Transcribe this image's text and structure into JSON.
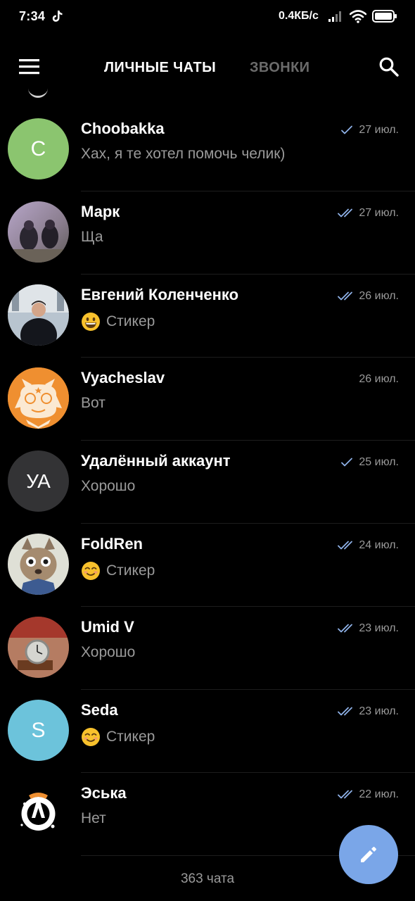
{
  "status_bar": {
    "time": "7:34",
    "net_speed": "0.4КБ/с"
  },
  "app_bar": {
    "tab_chats": "ЛИЧНЫЕ ЧАТЫ",
    "tab_calls": "ЗВОНКИ"
  },
  "chats": [
    {
      "name": "Choobakka",
      "preview": "Хах, я те хотел помочь челик)",
      "date": "27 июл.",
      "status": "sent",
      "avatar_letter": "C",
      "avatar_color": "#8bc56f",
      "avatar_type": "letter"
    },
    {
      "name": "Марк",
      "preview": "Ща",
      "date": "27 июл.",
      "status": "read",
      "avatar_type": "photo-people"
    },
    {
      "name": "Евгений Коленченко",
      "preview": "Стикер",
      "date": "26 июл.",
      "status": "read",
      "emoji": "grinning-face",
      "avatar_type": "photo-person"
    },
    {
      "name": "Vyacheslav",
      "preview": "Вот",
      "date": "26 июл.",
      "status": "none",
      "avatar_type": "mascot",
      "avatar_color": "#ef8f30"
    },
    {
      "name": "Удалённый аккаунт",
      "preview": "Хорошо",
      "date": "25 июл.",
      "status": "sent",
      "avatar_letter": "УА",
      "avatar_color": "#333335",
      "avatar_type": "letter"
    },
    {
      "name": "FoldRen",
      "preview": "Стикер",
      "date": "24 июл.",
      "status": "read",
      "emoji": "smiling-face",
      "avatar_type": "photo-cat"
    },
    {
      "name": "Umid V",
      "preview": "Хорошо",
      "date": "23 июл.",
      "status": "read",
      "avatar_type": "photo-watch"
    },
    {
      "name": "Seda",
      "preview": "Стикер",
      "date": "23 июл.",
      "status": "read",
      "emoji": "smiling-face",
      "avatar_letter": "S",
      "avatar_color": "#6cc3db",
      "avatar_type": "letter"
    },
    {
      "name": "Эська",
      "preview": "Нет",
      "date": "22 июл.",
      "status": "read",
      "avatar_type": "logo-overwatch"
    }
  ],
  "footer": {
    "chat_count": "363 чата"
  },
  "colors": {
    "accent": "#7aa6e8",
    "check": "#8fb2e8",
    "muted_text": "#9a9a9a"
  }
}
